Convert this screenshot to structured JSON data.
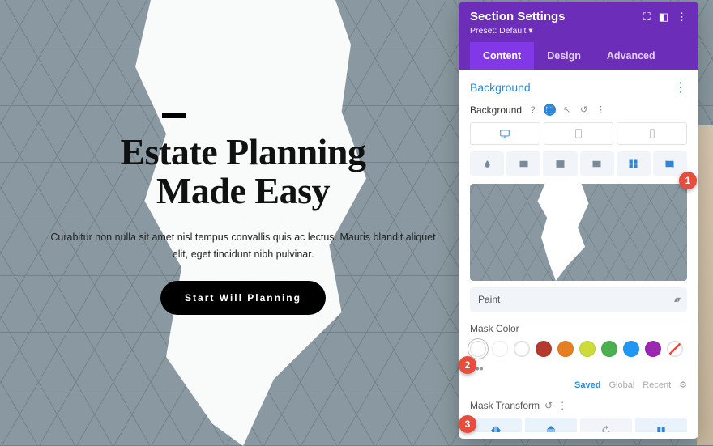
{
  "hero": {
    "title_l1": "Estate Planning",
    "title_l2": "Made Easy",
    "subtitle": "Curabitur non nulla sit amet nisl tempus convallis quis ac lectus. Mauris blandit aliquet elit, eget tincidunt nibh pulvinar.",
    "cta": "Start Will Planning"
  },
  "panel": {
    "title": "Section Settings",
    "preset": "Preset: Default ▾",
    "tabs": {
      "content": "Content",
      "design": "Design",
      "advanced": "Advanced"
    },
    "bg_heading": "Background",
    "bg_label": "Background",
    "mask_select": "Paint",
    "mask_color_label": "Mask Color",
    "palette": {
      "saved": "Saved",
      "global": "Global",
      "recent": "Recent"
    },
    "mask_transform_label": "Mask Transform",
    "colors": {
      "black": "#000000",
      "white": "#ffffff",
      "red": "#b5392f",
      "orange": "#e67e22",
      "yellow": "#cddc39",
      "green": "#4caf50",
      "blue": "#2196f3",
      "purple": "#9c27b0"
    }
  },
  "callouts": {
    "c1": "1",
    "c2": "2",
    "c3": "3"
  }
}
